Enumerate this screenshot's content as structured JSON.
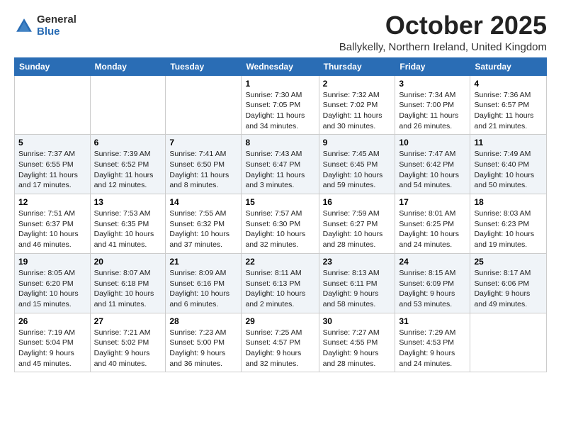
{
  "logo": {
    "general": "General",
    "blue": "Blue"
  },
  "title": "October 2025",
  "location": "Ballykelly, Northern Ireland, United Kingdom",
  "weekdays": [
    "Sunday",
    "Monday",
    "Tuesday",
    "Wednesday",
    "Thursday",
    "Friday",
    "Saturday"
  ],
  "weeks": [
    [
      {
        "day": "",
        "info": ""
      },
      {
        "day": "",
        "info": ""
      },
      {
        "day": "",
        "info": ""
      },
      {
        "day": "1",
        "info": "Sunrise: 7:30 AM\nSunset: 7:05 PM\nDaylight: 11 hours\nand 34 minutes."
      },
      {
        "day": "2",
        "info": "Sunrise: 7:32 AM\nSunset: 7:02 PM\nDaylight: 11 hours\nand 30 minutes."
      },
      {
        "day": "3",
        "info": "Sunrise: 7:34 AM\nSunset: 7:00 PM\nDaylight: 11 hours\nand 26 minutes."
      },
      {
        "day": "4",
        "info": "Sunrise: 7:36 AM\nSunset: 6:57 PM\nDaylight: 11 hours\nand 21 minutes."
      }
    ],
    [
      {
        "day": "5",
        "info": "Sunrise: 7:37 AM\nSunset: 6:55 PM\nDaylight: 11 hours\nand 17 minutes."
      },
      {
        "day": "6",
        "info": "Sunrise: 7:39 AM\nSunset: 6:52 PM\nDaylight: 11 hours\nand 12 minutes."
      },
      {
        "day": "7",
        "info": "Sunrise: 7:41 AM\nSunset: 6:50 PM\nDaylight: 11 hours\nand 8 minutes."
      },
      {
        "day": "8",
        "info": "Sunrise: 7:43 AM\nSunset: 6:47 PM\nDaylight: 11 hours\nand 3 minutes."
      },
      {
        "day": "9",
        "info": "Sunrise: 7:45 AM\nSunset: 6:45 PM\nDaylight: 10 hours\nand 59 minutes."
      },
      {
        "day": "10",
        "info": "Sunrise: 7:47 AM\nSunset: 6:42 PM\nDaylight: 10 hours\nand 54 minutes."
      },
      {
        "day": "11",
        "info": "Sunrise: 7:49 AM\nSunset: 6:40 PM\nDaylight: 10 hours\nand 50 minutes."
      }
    ],
    [
      {
        "day": "12",
        "info": "Sunrise: 7:51 AM\nSunset: 6:37 PM\nDaylight: 10 hours\nand 46 minutes."
      },
      {
        "day": "13",
        "info": "Sunrise: 7:53 AM\nSunset: 6:35 PM\nDaylight: 10 hours\nand 41 minutes."
      },
      {
        "day": "14",
        "info": "Sunrise: 7:55 AM\nSunset: 6:32 PM\nDaylight: 10 hours\nand 37 minutes."
      },
      {
        "day": "15",
        "info": "Sunrise: 7:57 AM\nSunset: 6:30 PM\nDaylight: 10 hours\nand 32 minutes."
      },
      {
        "day": "16",
        "info": "Sunrise: 7:59 AM\nSunset: 6:27 PM\nDaylight: 10 hours\nand 28 minutes."
      },
      {
        "day": "17",
        "info": "Sunrise: 8:01 AM\nSunset: 6:25 PM\nDaylight: 10 hours\nand 24 minutes."
      },
      {
        "day": "18",
        "info": "Sunrise: 8:03 AM\nSunset: 6:23 PM\nDaylight: 10 hours\nand 19 minutes."
      }
    ],
    [
      {
        "day": "19",
        "info": "Sunrise: 8:05 AM\nSunset: 6:20 PM\nDaylight: 10 hours\nand 15 minutes."
      },
      {
        "day": "20",
        "info": "Sunrise: 8:07 AM\nSunset: 6:18 PM\nDaylight: 10 hours\nand 11 minutes."
      },
      {
        "day": "21",
        "info": "Sunrise: 8:09 AM\nSunset: 6:16 PM\nDaylight: 10 hours\nand 6 minutes."
      },
      {
        "day": "22",
        "info": "Sunrise: 8:11 AM\nSunset: 6:13 PM\nDaylight: 10 hours\nand 2 minutes."
      },
      {
        "day": "23",
        "info": "Sunrise: 8:13 AM\nSunset: 6:11 PM\nDaylight: 9 hours\nand 58 minutes."
      },
      {
        "day": "24",
        "info": "Sunrise: 8:15 AM\nSunset: 6:09 PM\nDaylight: 9 hours\nand 53 minutes."
      },
      {
        "day": "25",
        "info": "Sunrise: 8:17 AM\nSunset: 6:06 PM\nDaylight: 9 hours\nand 49 minutes."
      }
    ],
    [
      {
        "day": "26",
        "info": "Sunrise: 7:19 AM\nSunset: 5:04 PM\nDaylight: 9 hours\nand 45 minutes."
      },
      {
        "day": "27",
        "info": "Sunrise: 7:21 AM\nSunset: 5:02 PM\nDaylight: 9 hours\nand 40 minutes."
      },
      {
        "day": "28",
        "info": "Sunrise: 7:23 AM\nSunset: 5:00 PM\nDaylight: 9 hours\nand 36 minutes."
      },
      {
        "day": "29",
        "info": "Sunrise: 7:25 AM\nSunset: 4:57 PM\nDaylight: 9 hours\nand 32 minutes."
      },
      {
        "day": "30",
        "info": "Sunrise: 7:27 AM\nSunset: 4:55 PM\nDaylight: 9 hours\nand 28 minutes."
      },
      {
        "day": "31",
        "info": "Sunrise: 7:29 AM\nSunset: 4:53 PM\nDaylight: 9 hours\nand 24 minutes."
      },
      {
        "day": "",
        "info": ""
      }
    ]
  ]
}
